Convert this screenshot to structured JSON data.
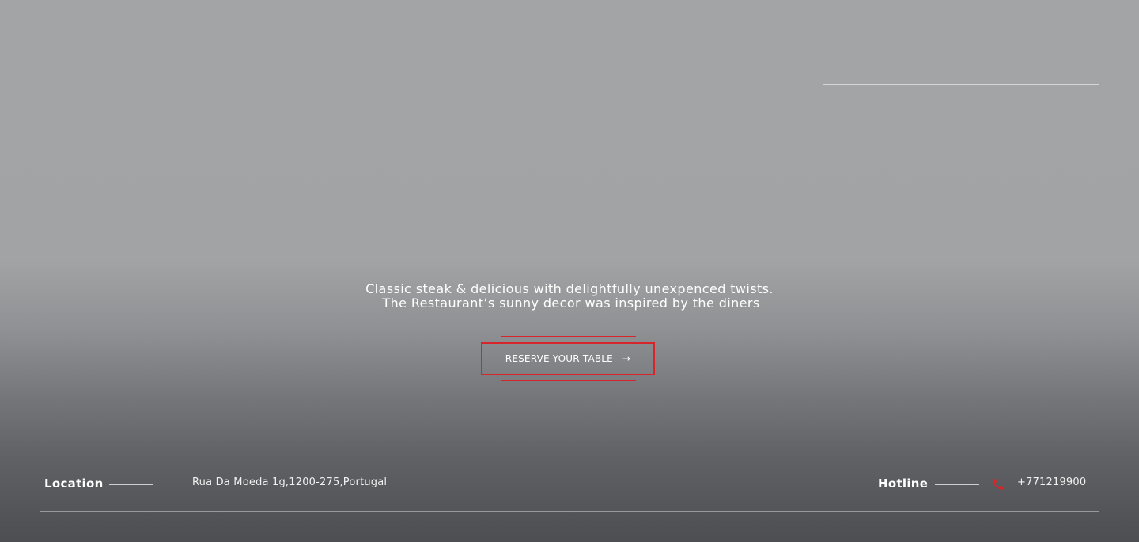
{
  "hero": {
    "tagline_line1": "Classic steak & delicious with delightfully unexpenced twists.",
    "tagline_line2": "The Restaurant’s sunny decor was inspired by the diners"
  },
  "reserve": {
    "label": "RESERVE YOUR TABLE",
    "arrow": "→",
    "accent_color": "#d6262c"
  },
  "footer": {
    "location_label": "Location",
    "location_value": "Rua Da Moeda 1g,1200-275,Portugal",
    "hotline_label": "Hotline",
    "hotline_icon": "phone-icon",
    "hotline_value": "+771219900"
  }
}
